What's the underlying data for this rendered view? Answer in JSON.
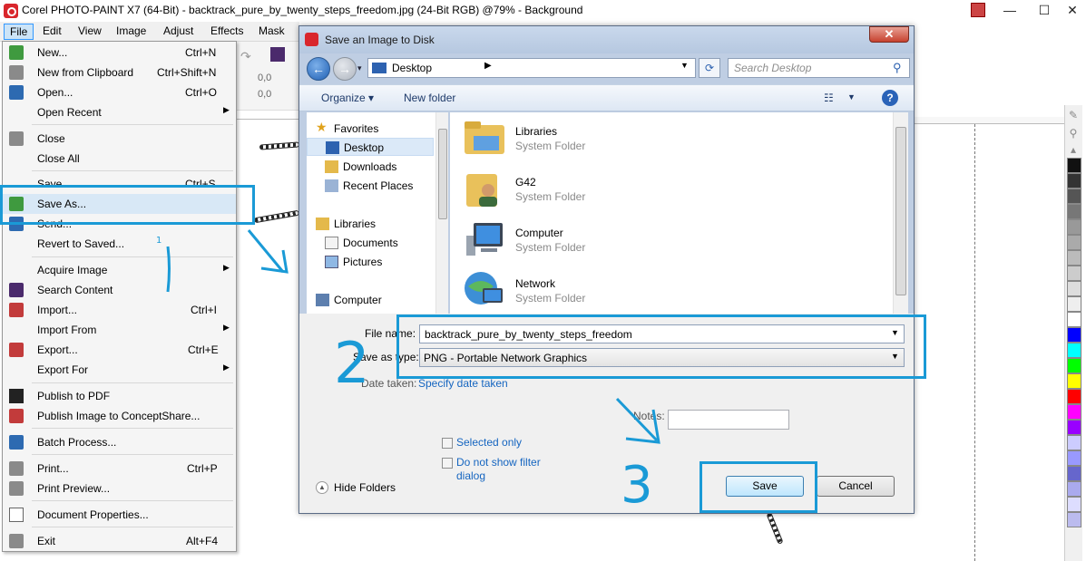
{
  "app": {
    "title": "Corel PHOTO-PAINT X7 (64-Bit) - backtrack_pure_by_twenty_steps_freedom.jpg (24-Bit RGB) @79% - Background",
    "minimize_glyph": "—",
    "maximize_glyph": "☐",
    "close_glyph": "✕",
    "menus": [
      "File",
      "Edit",
      "View",
      "Image",
      "Adjust",
      "Effects",
      "Mask"
    ],
    "toolbar_values": [
      "0,0",
      "0,0"
    ]
  },
  "file_menu": {
    "items": [
      {
        "label": "New...",
        "shortcut": "Ctrl+N",
        "icon": "new-document-icon"
      },
      {
        "label": "New from Clipboard",
        "shortcut": "Ctrl+Shift+N",
        "icon": "clipboard-icon"
      },
      {
        "label": "Open...",
        "shortcut": "Ctrl+O",
        "icon": "open-folder-icon"
      },
      {
        "label": "Open Recent",
        "shortcut": "",
        "submenu": true
      },
      {
        "label": "Close",
        "shortcut": "",
        "icon": "close-document-icon"
      },
      {
        "label": "Close All",
        "shortcut": ""
      },
      {
        "label": "Save",
        "shortcut": "Ctrl+S"
      },
      {
        "label": "Save As...",
        "shortcut": "",
        "icon": "save-as-icon",
        "highlighted": true
      },
      {
        "label": "Send...",
        "shortcut": "",
        "icon": "send-icon"
      },
      {
        "label": "Revert to Saved...",
        "shortcut": ""
      },
      {
        "label": "Acquire Image",
        "shortcut": "",
        "submenu": true
      },
      {
        "label": "Search Content",
        "shortcut": "",
        "icon": "search-content-icon"
      },
      {
        "label": "Import...",
        "shortcut": "Ctrl+I",
        "icon": "import-icon"
      },
      {
        "label": "Import From",
        "shortcut": "",
        "submenu": true
      },
      {
        "label": "Export...",
        "shortcut": "Ctrl+E",
        "icon": "export-icon"
      },
      {
        "label": "Export For",
        "shortcut": "",
        "submenu": true
      },
      {
        "label": "Publish to PDF",
        "shortcut": "",
        "icon": "pdf-icon"
      },
      {
        "label": "Publish Image to ConceptShare...",
        "shortcut": "",
        "icon": "conceptshare-icon"
      },
      {
        "label": "Batch Process...",
        "shortcut": "",
        "icon": "batch-icon"
      },
      {
        "label": "Print...",
        "shortcut": "Ctrl+P",
        "icon": "print-icon"
      },
      {
        "label": "Print Preview...",
        "shortcut": "",
        "icon": "print-preview-icon"
      },
      {
        "label": "Document Properties...",
        "shortcut": "",
        "icon": "properties-icon"
      },
      {
        "label": "Exit",
        "shortcut": "Alt+F4",
        "icon": "exit-icon"
      }
    ],
    "submenu_arrow": "▶"
  },
  "dialog": {
    "title": "Save an Image to Disk",
    "close_glyph": "✕",
    "address": "Desktop",
    "search_placeholder": "Search Desktop",
    "organize": "Organize ▾",
    "new_folder": "New folder",
    "nav": {
      "favorites": "Favorites",
      "desktop": "Desktop",
      "downloads": "Downloads",
      "recent_places": "Recent Places",
      "libraries": "Libraries",
      "documents": "Documents",
      "pictures": "Pictures",
      "computer": "Computer"
    },
    "files": [
      {
        "name": "Libraries",
        "type": "System Folder"
      },
      {
        "name": "G42",
        "type": "System Folder"
      },
      {
        "name": "Computer",
        "type": "System Folder"
      },
      {
        "name": "Network",
        "type": "System Folder"
      }
    ],
    "file_name_label": "File name:",
    "file_name_value": "backtrack_pure_by_twenty_steps_freedom",
    "save_as_type_label": "Save as type:",
    "save_as_type_value": "PNG - Portable Network Graphics",
    "date_taken_label": "Date taken:",
    "date_taken_link": "Specify date taken",
    "selected_only": "Selected only",
    "no_filter_dialog_1": "Do not show filter",
    "no_filter_dialog_2": "dialog",
    "notes_label": "Notes:",
    "hide_folders": "Hide Folders",
    "save_button": "Save",
    "cancel_button": "Cancel"
  },
  "annotations": {
    "step1": "1",
    "step2": "2",
    "step3": "3",
    "color": "#1a9ad6"
  },
  "palette_colors": [
    "#ffffff",
    "#0000ff",
    "#00ffff",
    "#00ff00",
    "#ffff00",
    "#ff0000",
    "#ff00ff",
    "#9900ff",
    "#ccccff",
    "#9999ff",
    "#6666cc",
    "#aaaaee",
    "#ddddff",
    "#bbbbee"
  ]
}
